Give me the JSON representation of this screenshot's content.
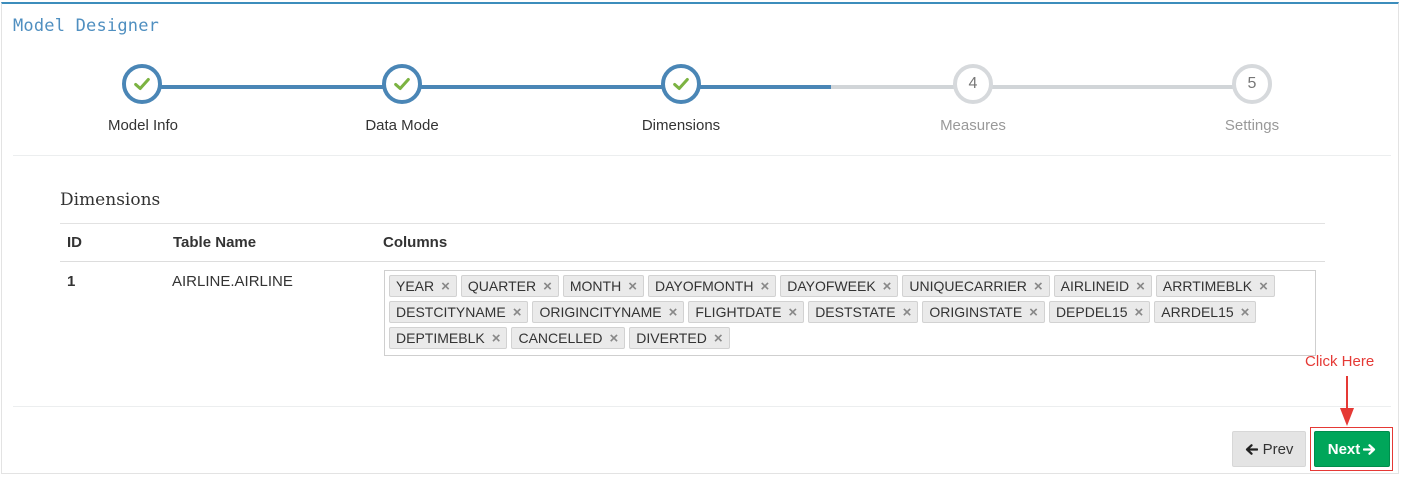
{
  "panel": {
    "title": "Model Designer"
  },
  "wizard": {
    "steps": [
      {
        "label": "Model Info",
        "state": "done",
        "marker": ""
      },
      {
        "label": "Data Mode",
        "state": "done",
        "marker": ""
      },
      {
        "label": "Dimensions",
        "state": "done",
        "marker": ""
      },
      {
        "label": "Measures",
        "state": "todo",
        "marker": "4"
      },
      {
        "label": "Settings",
        "state": "todo",
        "marker": "5"
      }
    ],
    "check_icon": "check-icon"
  },
  "dimensions": {
    "title": "Dimensions",
    "headers": {
      "id": "ID",
      "table": "Table Name",
      "columns": "Columns"
    },
    "rows": [
      {
        "id": "1",
        "table": "AIRLINE.AIRLINE",
        "columns": [
          "YEAR",
          "QUARTER",
          "MONTH",
          "DAYOFMONTH",
          "DAYOFWEEK",
          "UNIQUECARRIER",
          "AIRLINEID",
          "ARRTIMEBLK",
          "DESTCITYNAME",
          "ORIGINCITYNAME",
          "FLIGHTDATE",
          "DESTSTATE",
          "ORIGINSTATE",
          "DEPDEL15",
          "ARRDEL15",
          "DEPTIMEBLK",
          "CANCELLED",
          "DIVERTED"
        ]
      }
    ]
  },
  "annotation": {
    "text": "Click Here",
    "color": "#e53935"
  },
  "buttons": {
    "prev": "Prev",
    "next": "Next"
  },
  "colors": {
    "accent": "#4a86b6",
    "check": "#7cb342",
    "next_bg": "#00a65a",
    "inactive": "#d6d9dc"
  }
}
